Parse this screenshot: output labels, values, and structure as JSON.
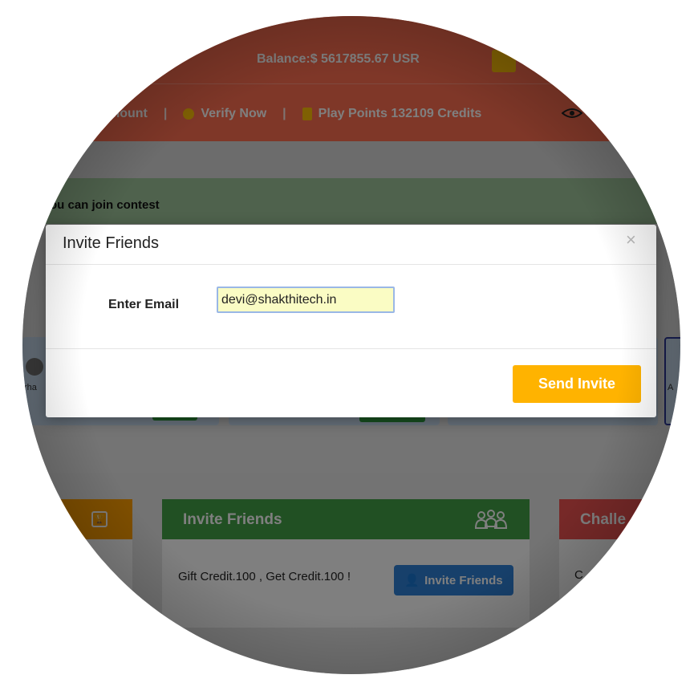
{
  "header": {
    "balance": "Balance:$ 5617855.67 USR",
    "nav_account": "mount",
    "nav_verify": "Verify Now",
    "nav_points": "Play Points 132109 Credits",
    "separator": "|"
  },
  "notice": {
    "text": "ou can join contest"
  },
  "cards_partial": {
    "left_text": "rha",
    "right_letter": "A"
  },
  "invite_card": {
    "title": "Invite Friends",
    "body_text": "Gift Credit.100 , Get Credit.100 !",
    "button_label": "Invite Friends"
  },
  "red_card": {
    "title": "Challe",
    "body_letter": "C"
  },
  "modal": {
    "title": "Invite Friends",
    "close_glyph": "×",
    "email_label": "Enter Email",
    "email_value": "devi@shakthitech.in",
    "send_label": "Send Invite"
  },
  "colors": {
    "topbar": "#ff6f50",
    "accent_yellow": "#ffb300",
    "invite_green": "#43a047",
    "invite_button_blue": "#2f80d6",
    "challenge_red": "#ef5350"
  },
  "icons": [
    "coin-icon",
    "credits-stack-icon",
    "eye-icon",
    "trophy-icon",
    "group-icon",
    "user-plus-icon",
    "close-icon",
    "flag-icon"
  ]
}
